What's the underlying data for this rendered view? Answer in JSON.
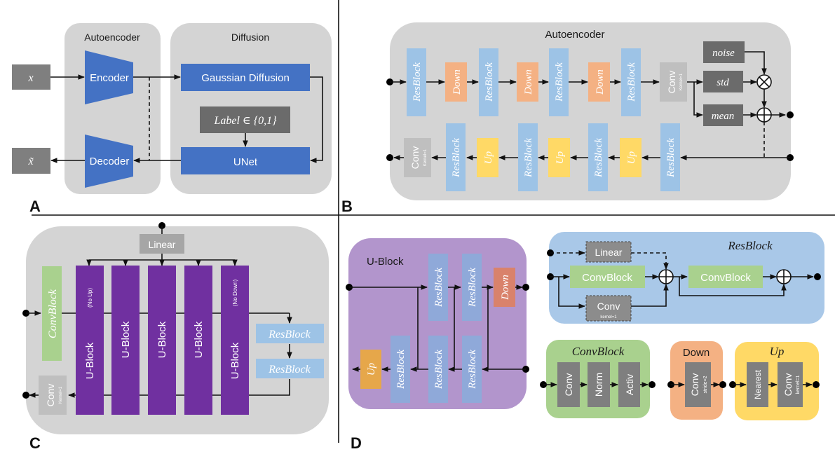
{
  "panels": {
    "A": {
      "letter": "A",
      "autoencoder_title": "Autoencoder",
      "diffusion_title": "Diffusion",
      "input": "x",
      "output": "x̃",
      "encoder": "Encoder",
      "decoder": "Decoder",
      "gaussian_diffusion": "Gaussian Diffusion",
      "label": "Label ∈ {0,1}",
      "unet": "UNet"
    },
    "B": {
      "letter": "B",
      "title": "Autoencoder",
      "resblock": "ResBlock",
      "down": "Down",
      "up": "Up",
      "conv": "Conv",
      "kernel": "Kernel=1",
      "noise": "noise",
      "std": "std",
      "mean": "mean"
    },
    "C": {
      "letter": "C",
      "linear": "Linear",
      "convblock": "ConvBlock",
      "ublock": "U-Block",
      "no_up": "(No Up)",
      "no_down": "(No Down)",
      "resblock": "ResBlock",
      "conv": "Conv",
      "kernel": "Kernel=1"
    },
    "D": {
      "letter": "D",
      "ublock_title": "U-Block",
      "resblock": "ResBlock",
      "down": "Down",
      "up": "Up",
      "resblock_title": "ResBlock",
      "linear": "Linear",
      "convblock": "ConvBlock",
      "conv": "Conv",
      "kernel_lower": "kernel=1",
      "convblock_title": "ConvBlock",
      "norm": "Norm",
      "activ": "Activ",
      "down_title": "Down",
      "stride": "stride=2",
      "up_title": "Up",
      "nearest": "Nearest"
    }
  }
}
